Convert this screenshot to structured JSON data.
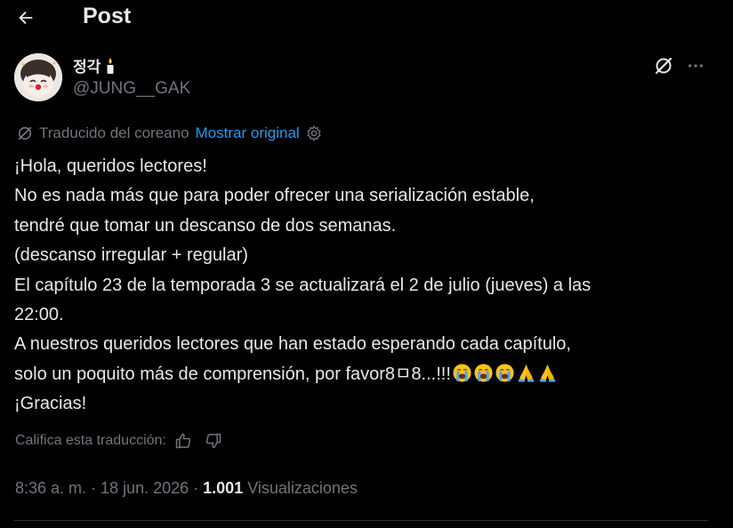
{
  "header": {
    "title": "Post"
  },
  "author": {
    "display_name": "정각",
    "handle": "@JUNG__GAK"
  },
  "translation": {
    "label": "Traducido del coreano",
    "show_original": "Mostrar original"
  },
  "post": {
    "lines": [
      "¡Hola, queridos lectores!",
      "No es nada más que para poder ofrecer una serialización estable,",
      "tendré que tomar un descanso de dos semanas.",
      "(descanso irregular + regular)",
      "El capítulo 23 de la temporada 3 se actualizará el 2 de julio (jueves) a las",
      "22:00.",
      "A nuestros queridos lectores que han estado esperando cada capítulo,",
      "solo un poquito más de comprensión, por favor8ㅁ8...!!!",
      "¡Gracias!"
    ],
    "emojis": [
      "loudly-crying-face",
      "loudly-crying-face",
      "loudly-crying-face",
      "folded-hands",
      "folded-hands"
    ]
  },
  "rate": {
    "label": "Califica esta traducción:"
  },
  "meta": {
    "time": "8:36 a. m.",
    "separator": "·",
    "date": "18 jun. 2026",
    "views_count": "1.001",
    "views_label": "Visualizaciones"
  },
  "icons": {
    "back": "arrow-left-icon",
    "name_badge": "candle-icon",
    "grok": "grok-icon",
    "more": "more-horizontal-icon",
    "translate": "translate-icon",
    "settings": "gear-icon",
    "like": "thumbs-up-icon",
    "dislike": "thumbs-down-icon"
  },
  "colors": {
    "background": "#000000",
    "text": "#e7e9ea",
    "secondary": "#71767b",
    "link": "#1d9bf0",
    "divider": "#2f3336"
  }
}
